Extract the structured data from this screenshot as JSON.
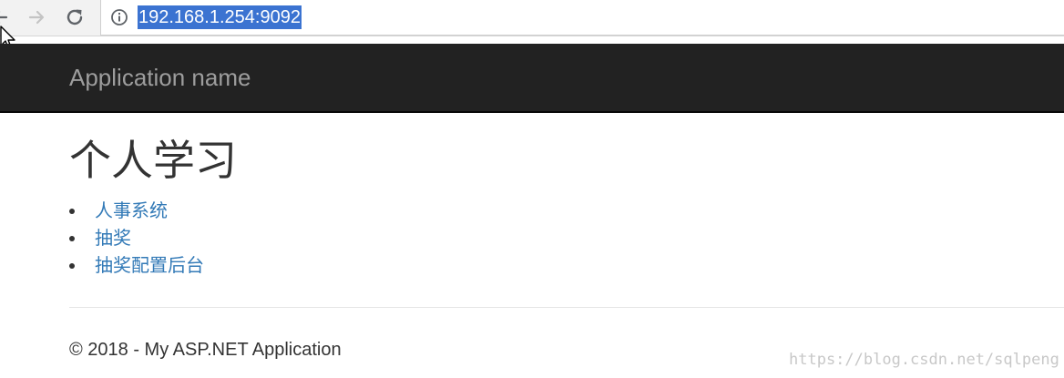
{
  "browser": {
    "address": "192.168.1.254:9092",
    "icons": {
      "back": "arrow-left-icon",
      "forward": "arrow-right-icon",
      "reload": "reload-icon",
      "site_info": "info-icon",
      "cursor": "mouse-pointer-icon"
    }
  },
  "navbar": {
    "brand": "Application name"
  },
  "main": {
    "title": "个人学习",
    "links": [
      {
        "label": "人事系统"
      },
      {
        "label": "抽奖"
      },
      {
        "label": "抽奖配置后台"
      }
    ]
  },
  "footer": {
    "text": "© 2018 - My ASP.NET Application"
  },
  "watermark": {
    "text": "https://blog.csdn.net/sqlpeng"
  },
  "colors": {
    "navbar_bg": "#222222",
    "brand": "#9d9d9d",
    "link": "#337ab7",
    "text": "#333333",
    "url_selection": "#3b73d1"
  }
}
